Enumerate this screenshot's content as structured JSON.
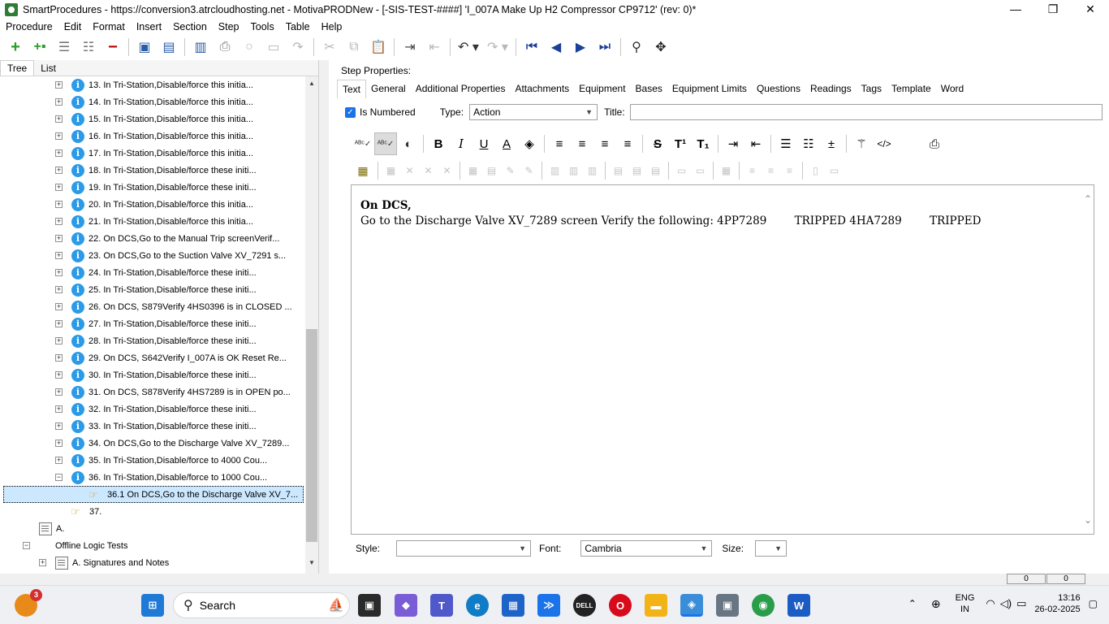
{
  "window": {
    "title": "SmartProcedures - https://conversion3.atrcloudhosting.net - MotivaPRODNew - [-SIS-TEST-####] 'I_007A Make Up H2 Compressor CP9712' (rev: 0)*",
    "min": "—",
    "max": "❐",
    "close": "✕"
  },
  "menu": [
    "Procedure",
    "Edit",
    "Format",
    "Insert",
    "Section",
    "Step",
    "Tools",
    "Table",
    "Help"
  ],
  "left_tabs": {
    "tree": "Tree",
    "list": "List"
  },
  "tree": [
    {
      "label": "13. In Tri-Station,Disable/force this initia...",
      "kind": "info"
    },
    {
      "label": "14. In Tri-Station,Disable/force this initia...",
      "kind": "info"
    },
    {
      "label": "15. In Tri-Station,Disable/force this initia...",
      "kind": "info"
    },
    {
      "label": "16. In Tri-Station,Disable/force this initia...",
      "kind": "info"
    },
    {
      "label": "17. In Tri-Station,Disable/force this initia...",
      "kind": "info"
    },
    {
      "label": "18. In Tri-Station,Disable/force these initi...",
      "kind": "info"
    },
    {
      "label": "19. In Tri-Station,Disable/force these initi...",
      "kind": "info"
    },
    {
      "label": "20. In Tri-Station,Disable/force this initia...",
      "kind": "info"
    },
    {
      "label": "21. In Tri-Station,Disable/force this initia...",
      "kind": "info"
    },
    {
      "label": "22. On DCS,Go to the Manual Trip screenVerif...",
      "kind": "info"
    },
    {
      "label": "23. On DCS,Go to the Suction Valve XV_7291 s...",
      "kind": "info"
    },
    {
      "label": "24. In Tri-Station,Disable/force these initi...",
      "kind": "info"
    },
    {
      "label": "25. In Tri-Station,Disable/force these initi...",
      "kind": "info"
    },
    {
      "label": "26. On DCS, S879Verify 4HS0396 is in CLOSED ...",
      "kind": "info"
    },
    {
      "label": "27. In Tri-Station,Disable/force these initi...",
      "kind": "info"
    },
    {
      "label": "28. In Tri-Station,Disable/force these initi...",
      "kind": "info"
    },
    {
      "label": "29. On DCS, S642Verify I_007A is OK Reset Re...",
      "kind": "info"
    },
    {
      "label": "30. In Tri-Station,Disable/force these initi...",
      "kind": "info"
    },
    {
      "label": "31. On DCS, S878Verify 4HS7289 is in OPEN po...",
      "kind": "info"
    },
    {
      "label": "32. In Tri-Station,Disable/force these initi...",
      "kind": "info"
    },
    {
      "label": "33. In Tri-Station,Disable/force these initi...",
      "kind": "info"
    },
    {
      "label": "34. On DCS,Go to the Discharge Valve XV_7289...",
      "kind": "info"
    },
    {
      "label": "35. In Tri-Station,Disable/force to 4000 Cou...",
      "kind": "info"
    },
    {
      "label": "36. In Tri-Station,Disable/force to 1000 Cou...",
      "kind": "info"
    },
    {
      "label": "36.1 On DCS,Go to the Discharge Valve XV_7...",
      "kind": "hand"
    },
    {
      "label": "37.",
      "kind": "hand"
    },
    {
      "label": "A.",
      "kind": "doc"
    },
    {
      "label": "Offline Logic Tests",
      "kind": "none"
    },
    {
      "label": "A. Signatures and Notes",
      "kind": "doc"
    }
  ],
  "step_properties": {
    "label": "Step Properties:",
    "tabs": [
      "Text",
      "General",
      "Additional Properties",
      "Attachments",
      "Equipment",
      "Bases",
      "Equipment Limits",
      "Questions",
      "Readings",
      "Tags",
      "Template",
      "Word"
    ],
    "is_numbered": "Is Numbered",
    "type_label": "Type:",
    "type_value": "Action",
    "title_label": "Title:",
    "title_value": ""
  },
  "editor": {
    "line1": "On DCS,",
    "line2": "Go to the Discharge Valve XV_7289 screen Verify the following: 4PP7289        TRIPPED 4HA7289        TRIPPED"
  },
  "bottom": {
    "style_label": "Style:",
    "style_value": "",
    "font_label": "Font:",
    "font_value": "Cambria",
    "size_label": "Size:",
    "size_value": ""
  },
  "status": {
    "a": "0",
    "b": "0"
  },
  "taskbar": {
    "search": "Search",
    "badge": "3",
    "lang1": "ENG",
    "lang2": "IN",
    "time": "13:16",
    "date": "26-02-2025"
  }
}
